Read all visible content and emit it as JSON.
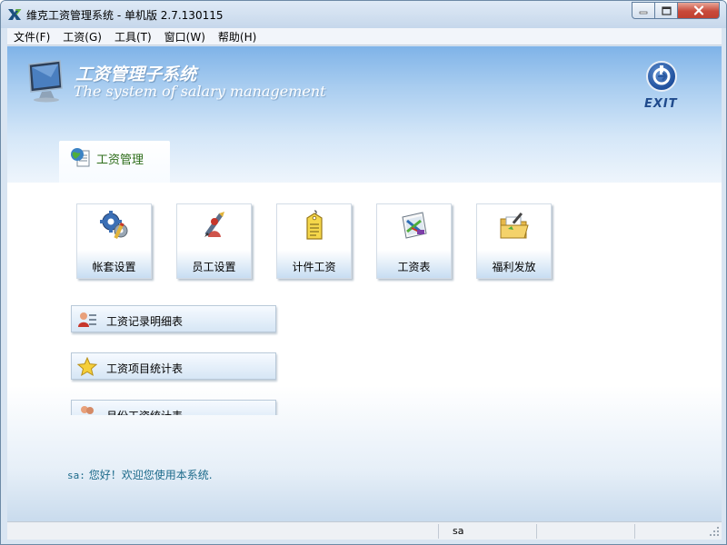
{
  "window": {
    "title": "维克工资管理系统 - 单机版 2.7.130115"
  },
  "menu": {
    "items": [
      {
        "label": "文件(F)"
      },
      {
        "label": "工资(G)"
      },
      {
        "label": "工具(T)"
      },
      {
        "label": "窗口(W)"
      },
      {
        "label": "帮助(H)"
      }
    ]
  },
  "header": {
    "title": "工资管理子系统",
    "subtitle": "The system of salary management",
    "exit_label": "EXIT"
  },
  "tab": {
    "label": "工资管理"
  },
  "tiles": [
    {
      "label": "帐套设置",
      "icon": "gears-icon"
    },
    {
      "label": "员工设置",
      "icon": "pen-person-icon"
    },
    {
      "label": "计件工资",
      "icon": "tag-icon"
    },
    {
      "label": "工资表",
      "icon": "chart-icon"
    },
    {
      "label": "福利发放",
      "icon": "folder-icon"
    }
  ],
  "reports": [
    {
      "label": "工资记录明细表",
      "icon": "user-list-icon"
    },
    {
      "label": "工资项目统计表",
      "icon": "star-icon"
    },
    {
      "label": "月份工资统计表",
      "icon": "users-icon"
    }
  ],
  "welcome": {
    "user": "sa:",
    "message": "您好！欢迎您使用本系统."
  },
  "status": {
    "user": "sa"
  },
  "colors": {
    "header_blue": "#7fb3e8",
    "tab_text": "#2e6d1a",
    "welcome_text": "#1c6a8a",
    "exit_blue": "#1f4a8c"
  }
}
